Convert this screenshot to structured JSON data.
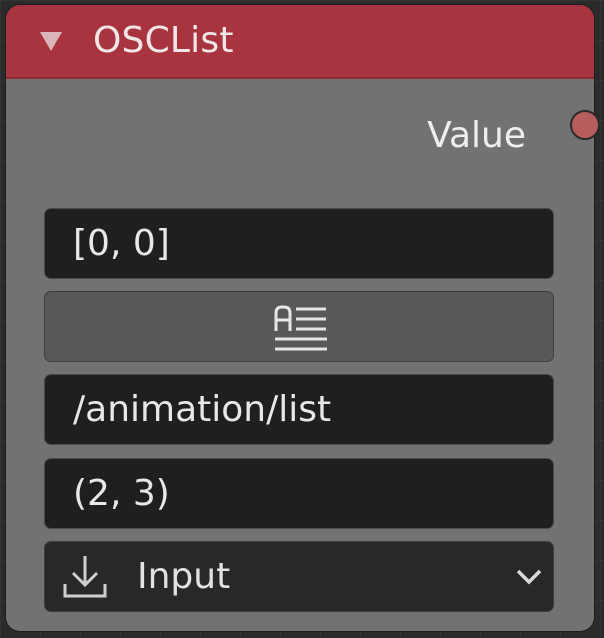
{
  "node": {
    "title": "OSCList",
    "header_color": "#a8343f",
    "body_color": "#727272",
    "collapse_icon": "triangle-down-icon"
  },
  "outputs": {
    "value_label": "Value",
    "socket_color": "#b85d5d"
  },
  "fields": {
    "list_value": "[0, 0]",
    "text_button_icon": "text-align-icon",
    "address": "/animation/list",
    "shape": "(2, 3)"
  },
  "mode_dropdown": {
    "icon": "import-icon",
    "selected": "Input",
    "chevron_icon": "chevron-down-icon"
  }
}
